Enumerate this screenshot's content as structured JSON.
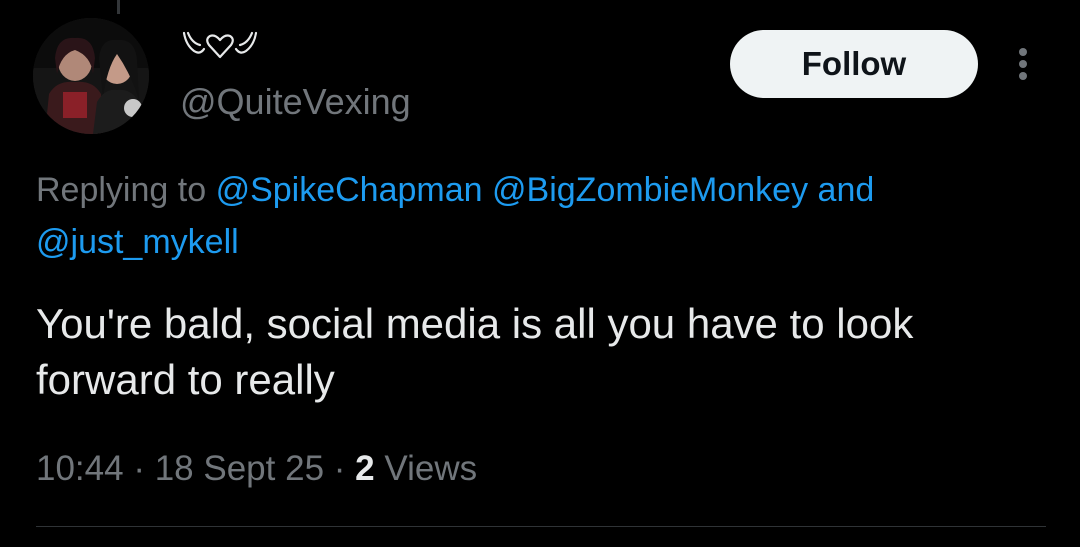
{
  "author": {
    "handle": "@QuiteVexing",
    "display_name_icon": "winged-heart-icon"
  },
  "follow_button": {
    "label": "Follow"
  },
  "more_menu": {
    "icon": "more-vertical-icon"
  },
  "reply_context": {
    "prefix": "Replying to",
    "mentions": [
      "@SpikeChapman",
      "@BigZombieMonkey",
      "@just_mykell"
    ],
    "conjunction": "and"
  },
  "tweet": {
    "text": "You're bald, social media is all you have to look forward to really"
  },
  "meta": {
    "time": "10:44",
    "separator": "·",
    "date": "18 Sept 25",
    "views_count": "2",
    "views_label": "Views"
  },
  "colors": {
    "background": "#000000",
    "text_primary": "#e7e9ea",
    "text_secondary": "#71767b",
    "link": "#1d9bf0",
    "follow_button_bg": "#eff3f4",
    "follow_button_text": "#0f1419",
    "divider": "#2f3336"
  }
}
